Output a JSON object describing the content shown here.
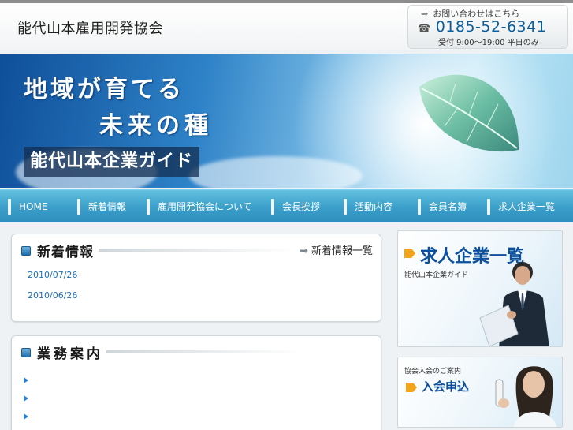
{
  "header": {
    "site_title": "能代山本雇用開発協会",
    "contact_label": "お問い合わせはこちら",
    "phone": "0185-52-6341",
    "hours": "受付 9:00〜19:00 平日のみ"
  },
  "banner": {
    "slogan_line1": "地域が育てる",
    "slogan_line2": "未来の種",
    "guide_title": "能代山本企業ガイド"
  },
  "nav": {
    "items": [
      "HOME",
      "新着情報",
      "雇用開発協会について",
      "会長挨拶",
      "活動内容",
      "会員名簿",
      "求人企業一覧"
    ]
  },
  "news": {
    "title": "新着情報",
    "more_link": "新着情報一覧",
    "dates": [
      "2010/07/26",
      "2010/06/26"
    ]
  },
  "business": {
    "title": "業務案内"
  },
  "sidebar": {
    "recruit_title": "求人企業一覧",
    "recruit_sub": "能代山本企業ガイド",
    "join_sub": "協会入会のご案内",
    "join_title": "入会申込"
  },
  "colors": {
    "accent": "#0c4f9c",
    "nav": "#3b9fca",
    "link": "#1d6fb8"
  }
}
